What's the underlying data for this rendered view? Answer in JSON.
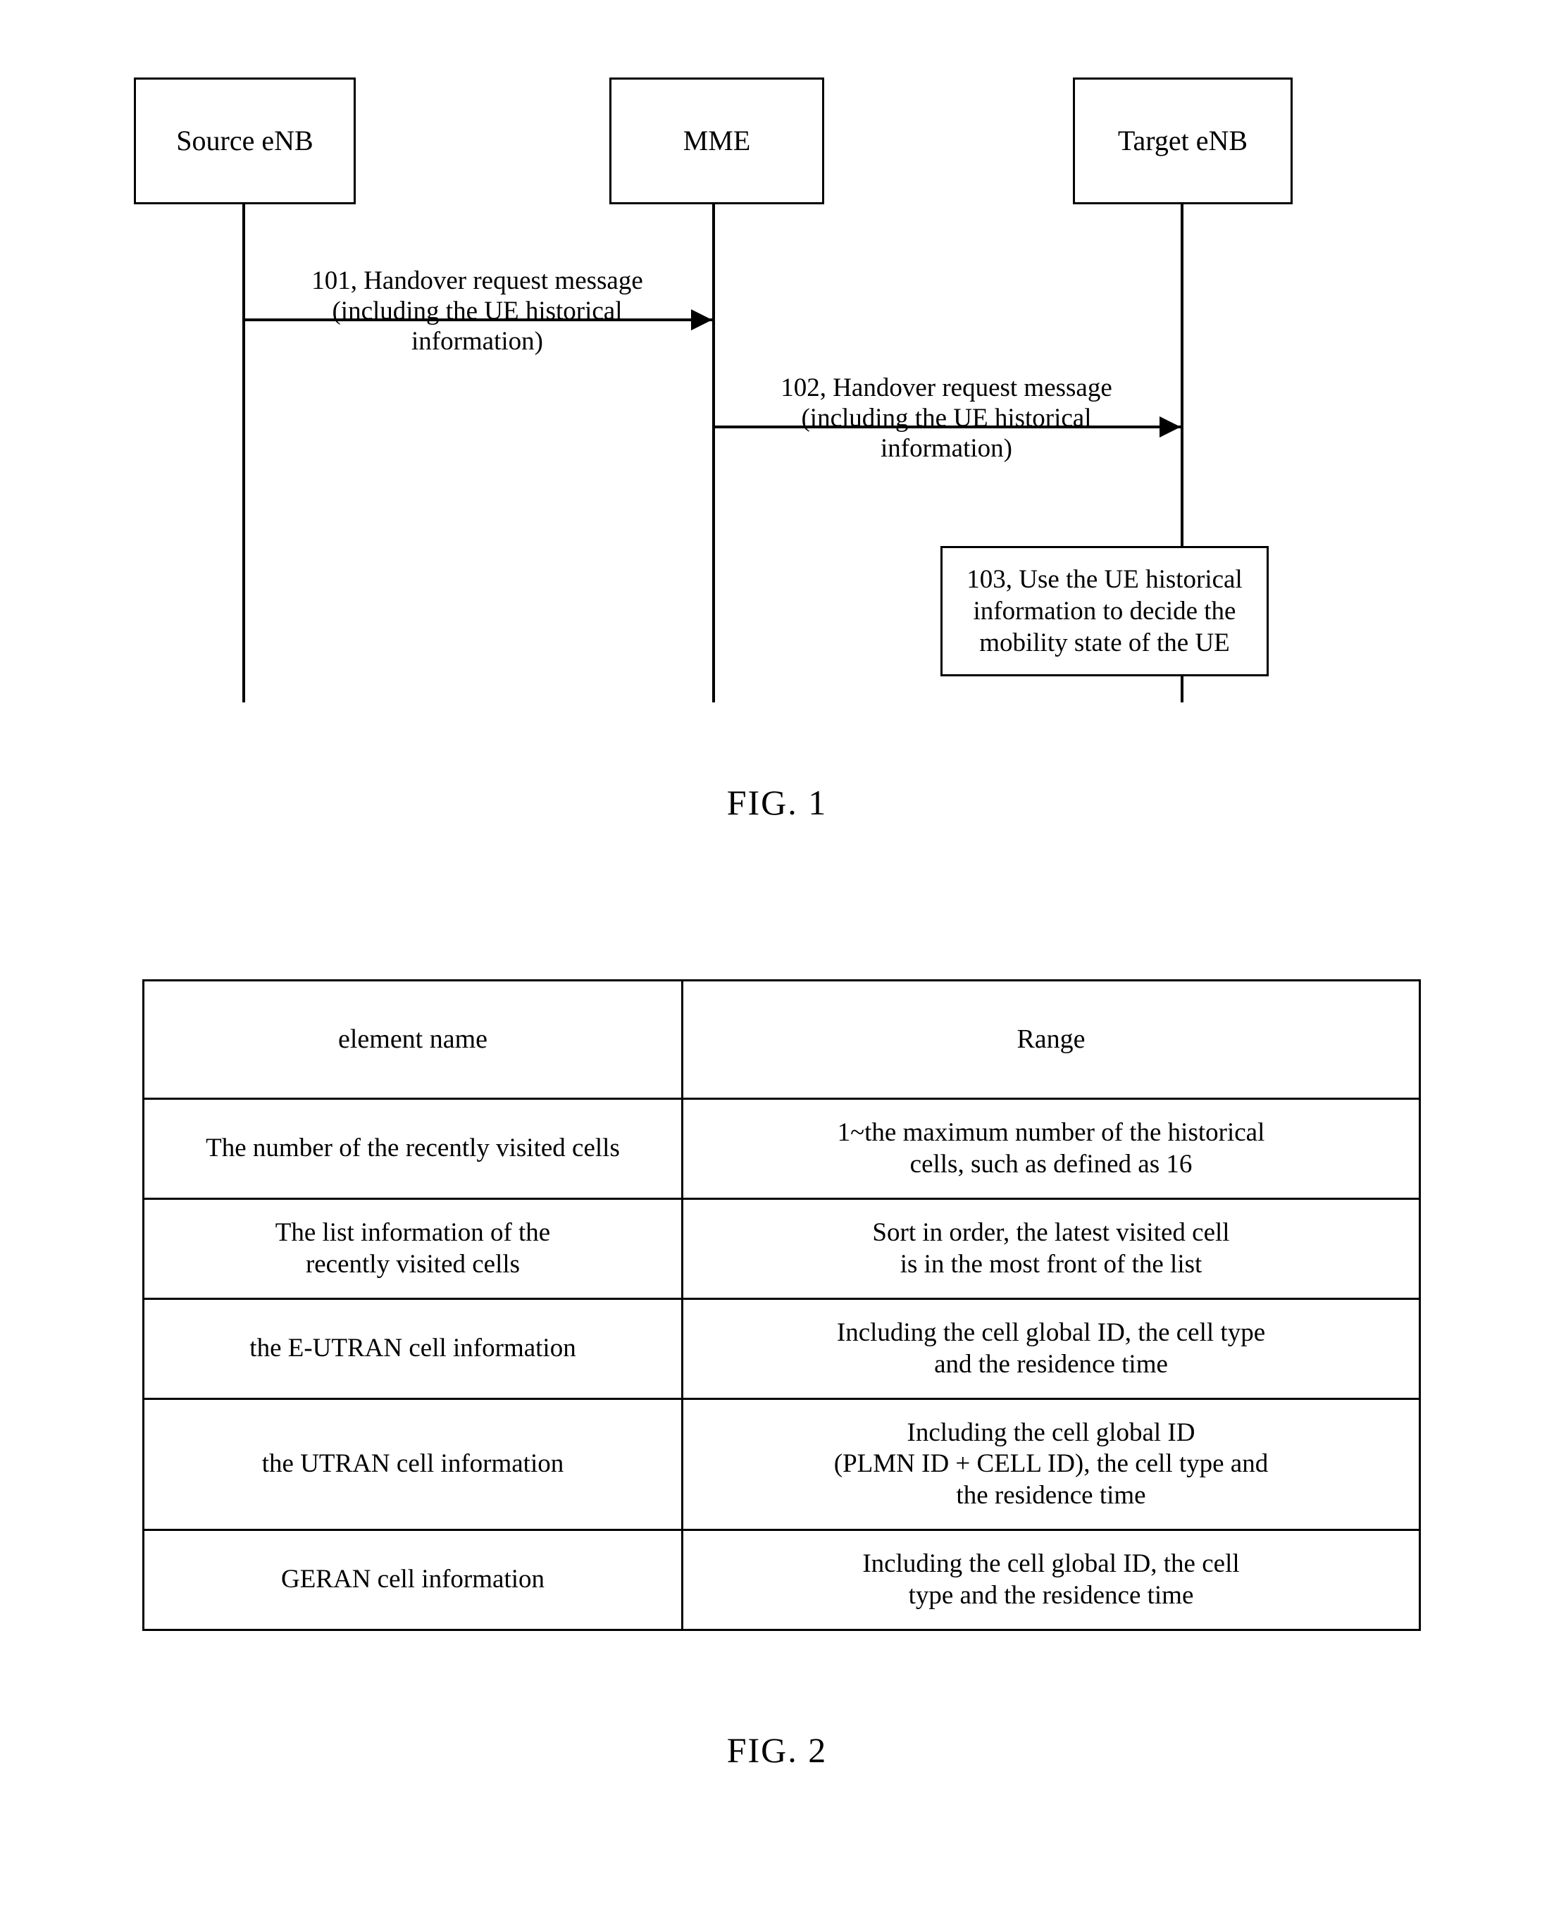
{
  "figure1": {
    "caption": "FIG. 1",
    "actors": [
      {
        "id": "source-enb",
        "label": "Source eNB"
      },
      {
        "id": "mme",
        "label": "MME"
      },
      {
        "id": "target-enb",
        "label": "Target eNB"
      }
    ],
    "messages": [
      {
        "id": "msg-101",
        "from": "source-enb",
        "to": "mme",
        "line1": "101, Handover request message",
        "line2": "(including the UE historical",
        "line3": "information)"
      },
      {
        "id": "msg-102",
        "from": "mme",
        "to": "target-enb",
        "line1": "102, Handover request message",
        "line2": "(including the UE historical",
        "line3": "information)"
      }
    ],
    "process": {
      "id": "step-103",
      "on": "target-enb",
      "line1": "103, Use the UE historical",
      "line2": "information to decide the",
      "line3": "mobility state of the UE"
    }
  },
  "figure2": {
    "caption": "FIG. 2",
    "table": {
      "headers": [
        "element name",
        "Range"
      ],
      "rows": [
        {
          "name": "The number of the recently visited cells",
          "range_line1": "1~the maximum number of the historical",
          "range_line2": "cells, such as defined as 16",
          "range_line3": ""
        },
        {
          "name_line1": "The list information of the",
          "name_line2": "recently visited cells",
          "name": "",
          "range_line1": "Sort in order, the latest visited cell",
          "range_line2": "is in the most front of the list",
          "range_line3": ""
        },
        {
          "name": "the E-UTRAN cell information",
          "range_line1": "Including the cell global ID, the cell type",
          "range_line2": "and the residence time",
          "range_line3": ""
        },
        {
          "name": "the UTRAN cell information",
          "range_line1": "Including the cell global ID",
          "range_line2": "(PLMN ID + CELL ID), the cell type and",
          "range_line3": "the residence time"
        },
        {
          "name": "GERAN cell information",
          "range_line1": "Including the cell global ID, the cell",
          "range_line2": "type and the residence time",
          "range_line3": ""
        }
      ]
    }
  }
}
